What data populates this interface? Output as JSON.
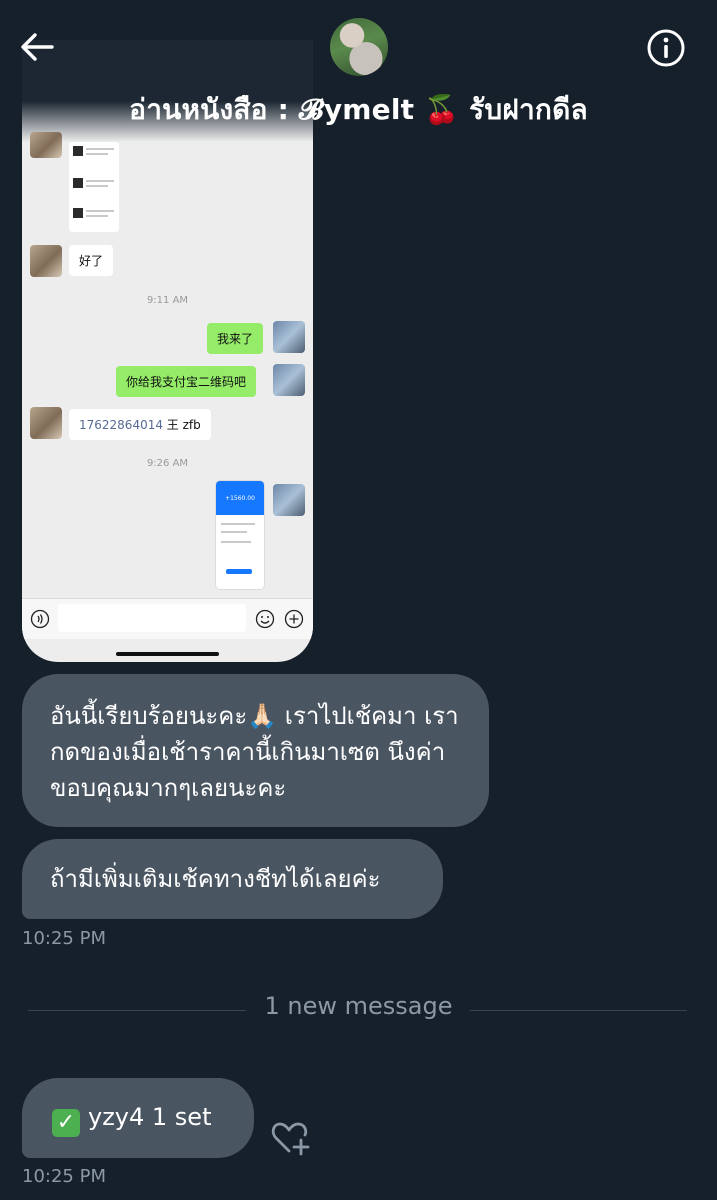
{
  "header": {
    "title": "อ่านหนังสือ : 𝓑ymelt 🍒 รับฝากดีล",
    "back_icon": "arrow-left-icon",
    "info_icon": "info-circle-icon"
  },
  "embedded_screenshot": {
    "messages": [
      {
        "side": "left",
        "text": "好了"
      },
      {
        "time": "9:11 AM"
      },
      {
        "side": "right",
        "text": "我来了"
      },
      {
        "side": "right",
        "text": "你给我支付宝二维码吧"
      },
      {
        "side": "left",
        "text": "17622864014 王 zfb"
      },
      {
        "time": "9:26 AM"
      }
    ],
    "time_1": "9:11 AM",
    "time_2": "9:26 AM",
    "msg_ok": "好了",
    "msg_here": "我来了",
    "msg_qr": "你给我支付宝二维码吧",
    "msg_phone": "17622864014",
    "msg_phone_suffix": " 王 zfb",
    "payment_amount": "+1560.00"
  },
  "conversation": {
    "message_1": "อันนี้เรียบร้อยนะคะ🙏🏻 เราไปเช้คมา เรากดของเมื่อเช้าราคานี้เกินมาเซต นึงค่า ขอบคุณมากๆเลยนะคะ",
    "message_2": "ถ้ามีเพิ่มเติมเช้คทางชีทได้เลยค่ะ",
    "timestamp_1": "10:25 PM",
    "divider": "1 new message",
    "message_3": "yzy4 1 set",
    "message_3_emoji": "✅",
    "timestamp_2": "10:25 PM",
    "react_icon": "heart-plus-icon"
  },
  "colors": {
    "background": "#15202b",
    "bubble": "#4a5562",
    "muted_text": "#8b98a5",
    "wechat_green": "#95ec69"
  }
}
